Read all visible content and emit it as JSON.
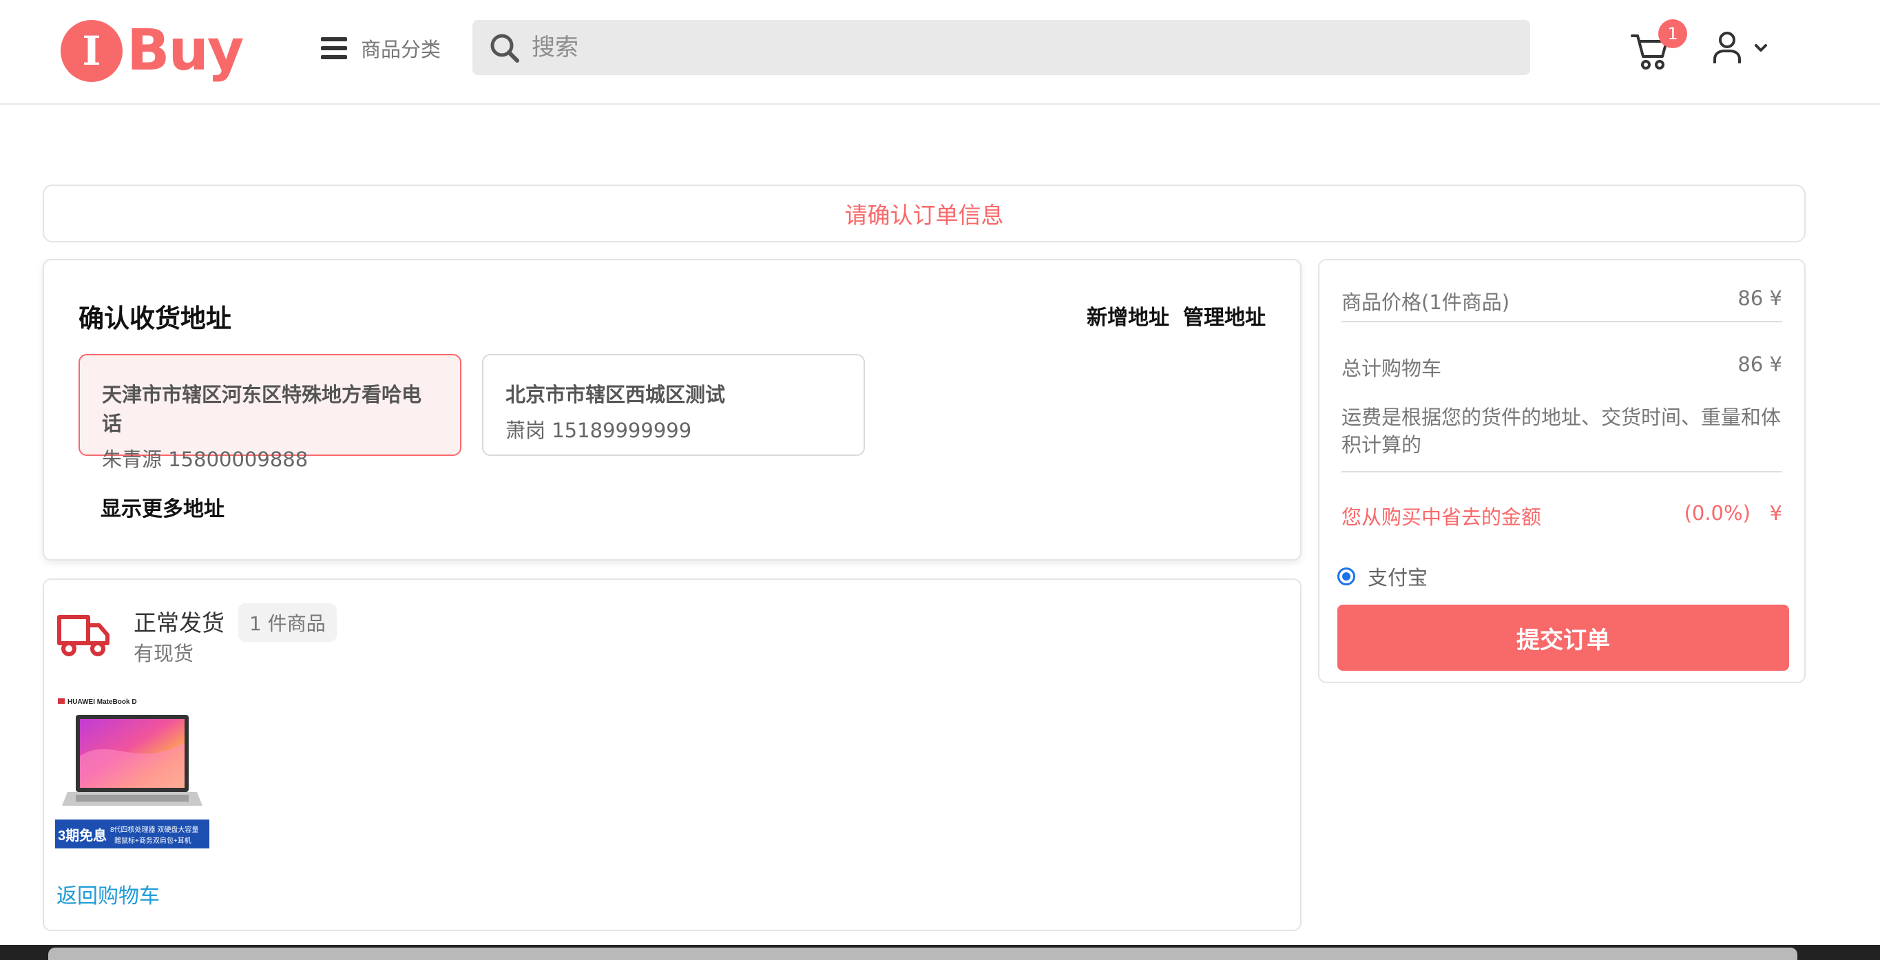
{
  "header": {
    "logo_letter": "I",
    "logo_text": "Buy",
    "category_label": "商品分类",
    "search_placeholder": "搜索",
    "cart_count": "1"
  },
  "confirm_banner": "请确认订单信息",
  "address": {
    "title": "确认收货地址",
    "add_label": "新增地址",
    "manage_label": "管理地址",
    "items": [
      {
        "line1": "天津市市辖区河东区特殊地方看哈电话",
        "line2": "朱青源 15800009888",
        "selected": true
      },
      {
        "line1": "北京市市辖区西城区测试",
        "line2": "萧岗 15189999999",
        "selected": false
      }
    ],
    "more_label": "显示更多地址"
  },
  "shipment": {
    "status": "正常发货",
    "stock": "有现货",
    "count": "1 件商品",
    "product_brand": "HUAWEI MateBook D",
    "product_badge": "3期免息",
    "product_promo1": "8代四核处理器 双硬盘大容量",
    "product_promo2": "赠鼠标+商务双肩包+耳机",
    "back_label": "返回购物车"
  },
  "summary": {
    "item_price_label": "商品价格(1件商品)",
    "item_price_value": "86 ¥",
    "cart_total_label": "总计购物车",
    "cart_total_value": "86 ¥",
    "shipping_note": "运费是根据您的货件的地址、交货时间、重量和体积计算的",
    "saved_label": "您从购买中省去的金额",
    "saved_value": "(0.0%)   ¥",
    "payment_method": "支付宝",
    "submit_label": "提交订单"
  },
  "colors": {
    "accent": "#f8696a",
    "link": "#1f9bd6",
    "radio": "#1a73e8"
  }
}
